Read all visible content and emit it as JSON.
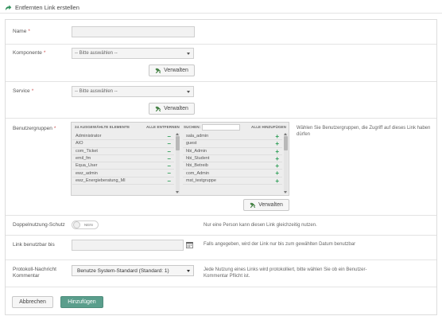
{
  "header": {
    "title": "Entfernten Link erstellen"
  },
  "form": {
    "name": {
      "label": "Name",
      "required": "*",
      "value": ""
    },
    "komponente": {
      "label": "Komponente",
      "required": "*",
      "selected": "-- Bitte auswählen --",
      "manage": "Verwalten"
    },
    "service": {
      "label": "Service",
      "required": "*",
      "selected": "-- Bitte auswählen --",
      "manage": "Verwalten"
    },
    "groups": {
      "label": "Benutzergruppen",
      "required": "*",
      "selected_header": "24 AUSGEWÄHLTE ELEMENTE",
      "remove_all": "ALLE ENTFERNEN",
      "search_label": "SUCHEN:",
      "search_value": "",
      "add_all": "ALLE HINZUFÜGEN",
      "remove_symbol": "–",
      "add_symbol": "+",
      "selected_items": [
        "Administrator",
        "AIO",
        "com_Ticket",
        "emil_fm",
        "Equa_User",
        "ewz_admin",
        "ewz_Energieberatung_MI"
      ],
      "available_items": [
        "sala_admin",
        "guest",
        "hbi_Admin",
        "hbi_Student",
        "hbi_Betreib",
        "com_Admin",
        "mst_testgruppe"
      ],
      "help": "Wählen Sie Benutzergruppen, die Zugriff auf dieses Link haben dürfen",
      "manage": "Verwalten"
    },
    "double_use": {
      "label": "Doppelnutzung-Schutz",
      "toggle_text": "NEIN",
      "help": "Nur eine Person kann diesen Link gleichzeitig nutzen."
    },
    "usable_until": {
      "label": "Link benutzbar bis",
      "value": "",
      "help": "Falls angegeben, wird der Link nur bis zum gewählten Datum benutzbar"
    },
    "protocol": {
      "label": "Protokoll-Nachricht",
      "label2": "Kommentar",
      "selected": "Benutze System-Standard (Standard: 1)",
      "help": "Jede Nutzung eines Links wird protokolliert, bitte wählen Sie ob ein Benutzer-Kommentar Pflicht ist."
    }
  },
  "actions": {
    "cancel": "Abbrechen",
    "submit": "Hinzufügen"
  },
  "colors": {
    "primary": "#5a9e8c",
    "add": "#2a9d54",
    "required": "#cc5555"
  },
  "icons": {
    "title": "share-arrow-icon",
    "manage": "tools-icon",
    "date": "calendar-icon"
  }
}
